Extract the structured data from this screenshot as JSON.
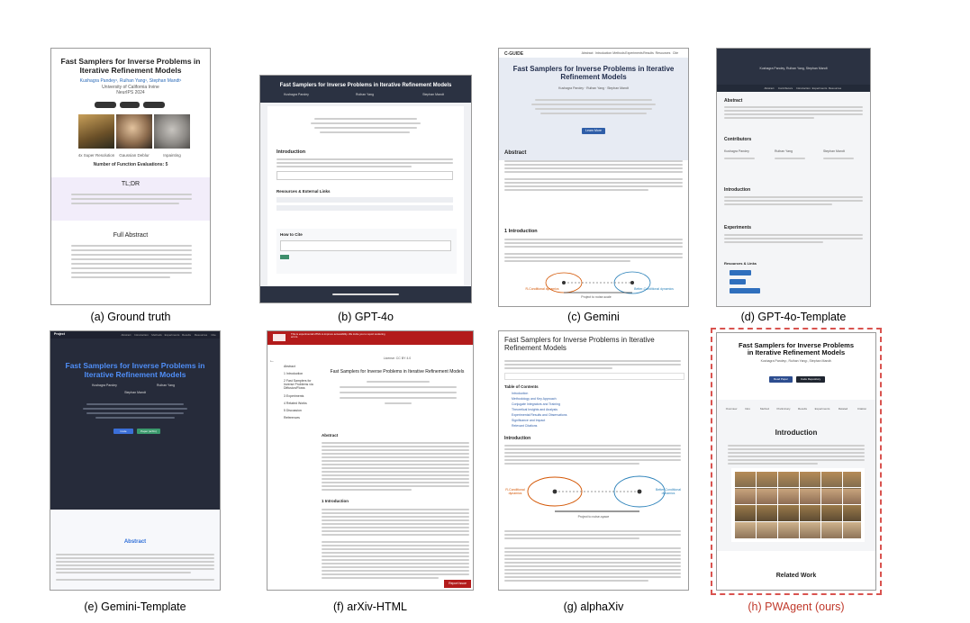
{
  "panels": [
    {
      "id": "a",
      "caption": "(a) Ground truth",
      "title_line1": "Fast Samplers for Inverse Problems in",
      "title_line2": "Iterative Refinement Models",
      "authors": "Kushagra Pandey¹, Ruihan Yang¹, Stephan Mandt¹",
      "affil1": "University of California Irvine",
      "affil2": "NeurIPS 2024",
      "buttons": [
        "Paper",
        "Code",
        "arXiv"
      ],
      "img_labels": [
        "4x Super Resolution",
        "Gaussian Deblur",
        "Inpainting"
      ],
      "img_tags": [
        "Degraded",
        "Original",
        "Degraded",
        "Original",
        "Degraded"
      ],
      "nfe": "Number of Function Evaluations: 5",
      "tldr": "TL;DR",
      "abstract": "Full Abstract"
    },
    {
      "id": "b",
      "caption": "(b) GPT-4o",
      "title": "Fast Samplers for Inverse Problems in Iterative Refinement Models",
      "authors": [
        "Kushagra Pandey",
        "Ruihan Yang",
        "Stephan Mandt"
      ],
      "intro": "Introduction",
      "res": "Resources & External Links",
      "howto": "How to Cite"
    },
    {
      "id": "c",
      "caption": "(c) Gemini",
      "nav_brand": "C-GUIDE",
      "nav": [
        "Abstract",
        "Introduction",
        "Methods",
        "Experiments",
        "Results",
        "Resources",
        "Cite"
      ],
      "title_line1": "Fast Samplers for Inverse Problems in Iterative",
      "title_line2": "Refinement Models",
      "authors": "Kushagra Pandey · Ruihan Yang · Stephan Mandt",
      "cta": "Learn More",
      "abstract": "Abstract",
      "intro": "1 Introduction",
      "dia_left": "R-Conditional dynamics",
      "dia_right": "Better-Conditional dynamics",
      "dia_mid": "Project to noise-scale"
    },
    {
      "id": "d",
      "caption": "(d) GPT-4o-Template",
      "header": "Kushagra Pandey, Ruihan Yang, Stephan Mandt",
      "nav": [
        "Abstract",
        "Contributors",
        "Introduction",
        "Experiments",
        "Resources"
      ],
      "abstract": "Abstract",
      "contrib": "Contributors",
      "people": [
        "Kushagra Pandey",
        "Ruihan Yang",
        "Stephan Mandt"
      ],
      "intro": "Introduction",
      "exp": "Experiments",
      "res": "Resources & Links",
      "links": [
        "Project Code",
        "Paper PDF",
        "Supplementary Material"
      ]
    },
    {
      "id": "e",
      "caption": "(e) Gemini-Template",
      "brand": "Project",
      "nav": [
        "Abstract",
        "Introduction",
        "Methods",
        "Experiments",
        "Results",
        "Resources",
        "Cite"
      ],
      "title_line1": "Fast Samplers for Inverse Problems in",
      "title_line2": "Iterative Refinement Models",
      "authors": [
        "Kushagra Pandey",
        "Ruihan Yang"
      ],
      "author3": "Stephan Mandt",
      "buttons": [
        "Code",
        "Paper (arXiv)"
      ],
      "abstract": "Abstract"
    },
    {
      "id": "f",
      "caption": "(f) arXiv-HTML",
      "banner": "This is experimental HTML to improve accessibility. We invite you to report rendering errors.",
      "toc": [
        "Abstract",
        "1 Introduction",
        "2 Fast Samplers for Inverse Problems via Diffusion/Flows",
        "3 Experiments",
        "4 Related Works",
        "5 Discussion",
        "References"
      ],
      "date": "License: CC BY 4.0",
      "title": "Fast Samplers for Inverse Problems in Iterative Refinement Models",
      "abstract": "Abstract",
      "intro": "1 Introduction",
      "report": "Report Issue"
    },
    {
      "id": "g",
      "caption": "(g) alphaXiv",
      "title_line1": "Fast Samplers for Inverse Problems in Iterative",
      "title_line2": "Refinement Models",
      "toc": "Table of Contents",
      "toc_items": [
        "Introduction",
        "Methodology and Key Approach",
        "Conjugate Integrators and Training",
        "Theoretical Insights and Analysis",
        "Experimental Results and Observations",
        "Significance and Impact",
        "Relevant Citations"
      ],
      "intro": "Introduction",
      "dia_left": "R-Conditional dynamics",
      "dia_right": "Better-Conditional dynamics",
      "dia_mid": "Project to noise-space"
    },
    {
      "id": "h",
      "caption": "(h) PWAgent (ours)",
      "title_line1": "Fast Samplers for Inverse Problems",
      "title_line2": "in Iterative Refinement Models",
      "authors": "Kushagra Pandey¹, Ruihan Yang¹, Stephan Mandt¹",
      "buttons": [
        "Read Paper",
        "Code Repository"
      ],
      "nav": [
        "Overview",
        "Intro",
        "Method",
        "Preliminary",
        "Results",
        "Experiments",
        "Related",
        "Citation"
      ],
      "intro": "Introduction",
      "related": "Related Work"
    }
  ],
  "colors": {
    "accent_red": "#c0392b",
    "dark_header": "#2b3242",
    "purple_band": "#f2edfa",
    "navy": "#1f2b4a"
  }
}
